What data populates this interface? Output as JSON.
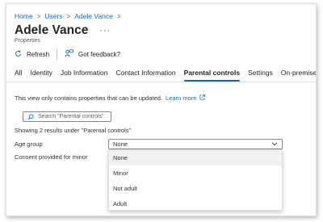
{
  "breadcrumb": {
    "items": [
      "Home",
      "Users",
      "Adele Vance"
    ],
    "separator": ">"
  },
  "header": {
    "title": "Adele Vance",
    "more_label": "···",
    "subtitle": "Properties"
  },
  "toolbar": {
    "refresh_label": "Refresh",
    "feedback_label": "Got feedback?"
  },
  "tabs": [
    {
      "label": "All",
      "active": false
    },
    {
      "label": "Identity",
      "active": false
    },
    {
      "label": "Job Information",
      "active": false
    },
    {
      "label": "Contact Information",
      "active": false
    },
    {
      "label": "Parental controls",
      "active": true
    },
    {
      "label": "Settings",
      "active": false
    },
    {
      "label": "On-premises",
      "active": false
    }
  ],
  "notice": {
    "text": "This view only contains properties that can be updated.",
    "link": "Learn more"
  },
  "search": {
    "placeholder": "Search \"Parental controls\" ..."
  },
  "results_text": "Showing 2 results under \"Parental controls\"",
  "fields": {
    "age_group_label": "Age group",
    "age_group_value": "None",
    "consent_label": "Consent provided for minor"
  },
  "dropdown": {
    "options": [
      "None",
      "Minor",
      "Not adult",
      "Adult"
    ],
    "selected": "None"
  },
  "colors": {
    "accent": "#0f6cbd",
    "text": "#323130",
    "border": "#8a8886",
    "selected_bg": "#f3f2f1"
  }
}
